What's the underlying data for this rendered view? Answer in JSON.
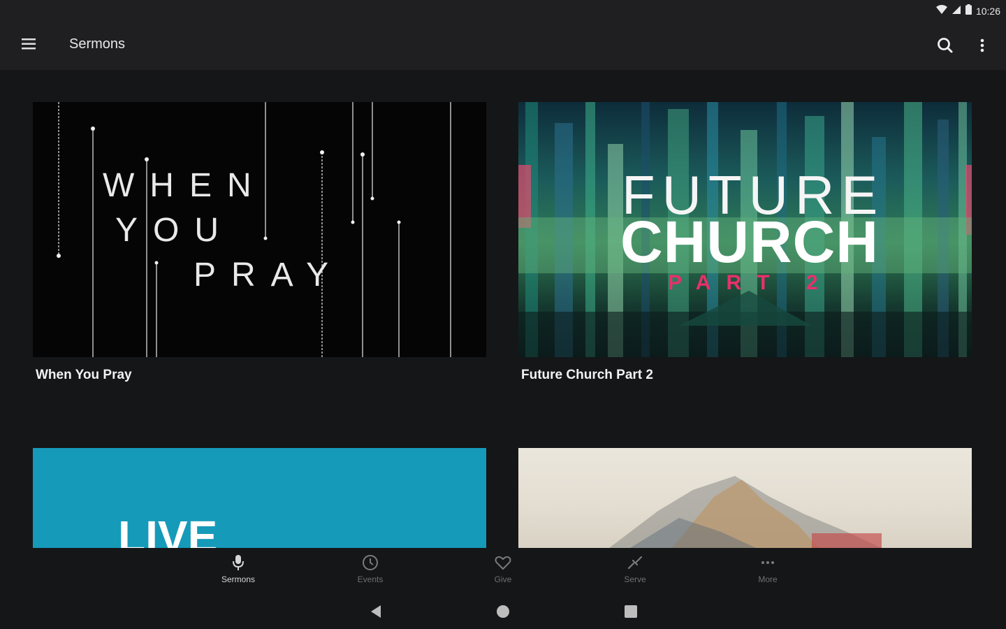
{
  "status_bar": {
    "time": "10:26",
    "icons": [
      "wifi-icon",
      "signal-icon",
      "battery-icon"
    ]
  },
  "app_bar": {
    "title": "Sermons",
    "icons": {
      "menu": "menu-icon",
      "search": "search-icon",
      "overflow": "more-vert-icon"
    }
  },
  "cards": [
    {
      "title": "When You Pray",
      "thumb_text": [
        "WHEN",
        "YOU",
        "PRAY"
      ]
    },
    {
      "title": "Future Church Part 2",
      "thumb_text": [
        "FUTURE",
        "CHURCH",
        "PART 2"
      ]
    },
    {
      "title": "",
      "thumb_text": [
        "LIVE"
      ]
    },
    {
      "title": "",
      "thumb_text": []
    }
  ],
  "bottom_nav": {
    "items": [
      {
        "label": "Sermons",
        "icon": "microphone-icon",
        "active": true
      },
      {
        "label": "Events",
        "icon": "clock-icon",
        "active": false
      },
      {
        "label": "Give",
        "icon": "heart-icon",
        "active": false
      },
      {
        "label": "Serve",
        "icon": "handshake-icon",
        "active": false
      },
      {
        "label": "More",
        "icon": "more-horiz-icon",
        "active": false
      }
    ]
  },
  "system_nav": {
    "icons": [
      "back-icon",
      "home-icon",
      "recents-icon"
    ]
  },
  "colors": {
    "background": "#151618",
    "app_bar": "#1f1f21",
    "live_tile": "#169ab9",
    "future_accent": "#e8306a",
    "nav_inactive": "#6f7072",
    "nav_active": "#d6d6d6"
  }
}
